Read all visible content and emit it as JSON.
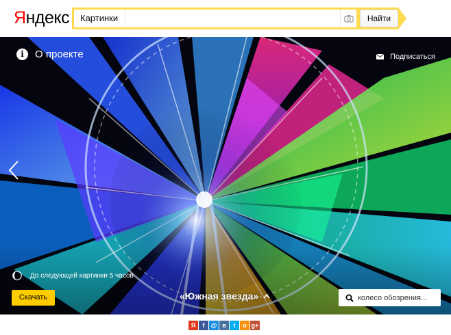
{
  "header": {
    "logo_first": "Я",
    "logo_rest": "ндекс",
    "search_tab": "Картинки",
    "search_value": "",
    "search_placeholder": "",
    "find_label": "Найти"
  },
  "hero": {
    "about_label": "О проекте",
    "subscribe_label": "Подписаться",
    "timer_text": "До следующей картинки 5 часов",
    "download_label": "Скачать",
    "caption": "«Южная звезда»",
    "search_tag": "колесо обозрения..."
  },
  "share": {
    "icons": [
      {
        "name": "ya-share-icon",
        "glyph": "Я",
        "color": "#e03a1e"
      },
      {
        "name": "facebook-icon",
        "glyph": "f",
        "color": "#3b5998"
      },
      {
        "name": "moimir-icon",
        "glyph": "@",
        "color": "#168de2"
      },
      {
        "name": "vkontakte-icon",
        "glyph": "в",
        "color": "#48729e"
      },
      {
        "name": "twitter-icon",
        "glyph": "t",
        "color": "#00aced"
      },
      {
        "name": "odnoklassniki-icon",
        "glyph": "о",
        "color": "#f59310"
      },
      {
        "name": "googleplus-icon",
        "glyph": "g+",
        "color": "#c25234"
      }
    ]
  },
  "colors": {
    "accent": "#ffdb4d",
    "download": "#ffcc00",
    "logo_red": "#ff0000"
  }
}
